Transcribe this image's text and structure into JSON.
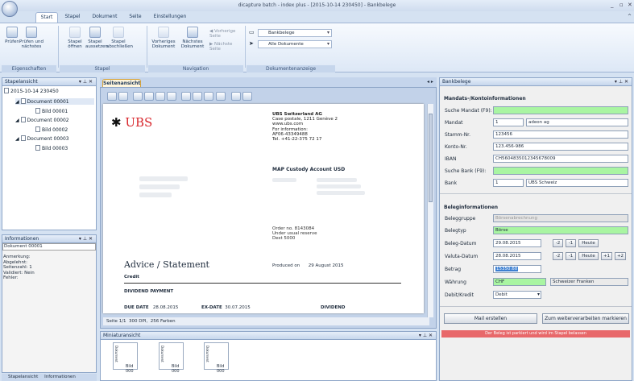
{
  "window": {
    "title": "dicapture batch - index plus - [2015-10-14 230450] - Bankbelege"
  },
  "tabs": [
    "Start",
    "Stapel",
    "Dokument",
    "Seite",
    "Einstellungen"
  ],
  "ribbon": {
    "groups": [
      "Eigenschaften",
      "Stapel",
      "Navigation",
      "Dokumentenanzeige"
    ],
    "buttons": {
      "pruefen": "Prüfen",
      "pruefen_naechstes": "Prüfen und nächstes",
      "stapel_oeffnen": "Stapel öffnen",
      "stapel_aussetzen": "Stapel aussetzen",
      "stapel_abschliessen": "Stapel abschließen",
      "vorheriges_dokument": "Vorheriges Dokument",
      "naechstes_dokument": "Nächstes Dokument",
      "vorherige_seite": "Vorherige Seite",
      "naechste_seite": "Nächste Seite"
    },
    "dropdown1": "Bankbelege",
    "dropdown2": "Alle Dokumente"
  },
  "stapel_panel": {
    "title": "Stapelansicht",
    "root": "2015-10-14 230450",
    "items": [
      "Document 00001",
      "Bild 00001",
      "Document 00002",
      "Bild 00002",
      "Document 00003",
      "Bild 00003"
    ]
  },
  "info_panel": {
    "title": "Informationen",
    "doc": "Dokument 00001",
    "lines": [
      "Anmerkung:",
      "Abgelehnt:",
      "Seitenzahl: 1",
      "Validiert: Nein",
      "Fehler:"
    ]
  },
  "bottom_tabs": [
    "Stapelansicht",
    "Informationen"
  ],
  "viewer": {
    "tab": "Seitenansicht",
    "status": {
      "page": "Seite 1/1",
      "dpi": "300 DPI,",
      "colors": "256 Farben"
    },
    "doc": {
      "bank_name": "UBS",
      "addr": [
        "UBS Switzerland AG",
        "Case postale, 1211 Genève 2",
        "www.ubs.com",
        "",
        "For information:",
        "AF06-43349488",
        "Tel. +41-22-375 72 17"
      ],
      "custody": "MAP Custody Account USD",
      "order": [
        "Order no. 8143084",
        "Under usual reserve",
        "Dest 5000"
      ],
      "heading": "Advice / Statement",
      "produced_label": "Produced on",
      "produced_date": "29 August 2015",
      "credit": "Credit",
      "dividend_payment": "DIVIDEND PAYMENT",
      "due_date_label": "DUE DATE",
      "due_date": "28.08.2015",
      "ex_date_label": "EX-DATE",
      "ex_date": "30.07.2015",
      "dividend": "DIVIDEND"
    }
  },
  "miniatur": {
    "title": "Miniaturansicht",
    "items": [
      "Bild 000",
      "Bild 000",
      "Bild 000"
    ],
    "thumb_tag": "Dokument"
  },
  "right_panel": {
    "title": "Bankbelege",
    "section1": "Mandats-/Kontoinformationen",
    "suche_mandat_label": "Suche Mandat (F9):",
    "mandat_label": "Mandat",
    "mandat_value": "1",
    "mandat_name": "adeon ag",
    "stamm_label": "Stamm-Nr.",
    "stamm_value": "123456",
    "konto_label": "Konto-Nr.",
    "konto_value": "123.456-986",
    "iban_label": "IBAN",
    "iban_value": "CH5604835012345678009",
    "suche_bank_label": "Suche Bank (F9):",
    "bank_label": "Bank",
    "bank_value": "1",
    "bank_name": "UBS Schweiz",
    "section2": "Beleginformationen",
    "beleggruppe_label": "Beleggruppe",
    "beleggruppe_value": "Börsenabrechnung",
    "belegtyp_label": "Belegtyp",
    "belegtyp_value": "Börse",
    "belegdatum_label": "Beleg-Datum",
    "belegdatum_value": "29.08.2015",
    "valuta_label": "Valuta-Datum",
    "valuta_value": "28.08.2015",
    "betrag_label": "Betrag",
    "betrag_value": "15350.60",
    "waehrung_label": "Währung",
    "waehrung_value": "CHF",
    "waehrung_name": "Schweizer Franken",
    "debit_label": "Debit/Kredit",
    "debit_value": "Debit",
    "btn_minus2": "-2",
    "btn_minus1": "-1",
    "btn_heute": "Heute",
    "btn_plus1": "+1",
    "btn_plus2": "+2",
    "mail_btn": "Mail erstellen",
    "weiter_btn": "Zum weiterverarbeiten markieren",
    "status_msg": "Der Beleg ist parkiert und wird im Stapel belassen"
  },
  "colors": {
    "accent": "#3c7fd1",
    "green_field": "#a9f5a2",
    "error_bar": "#e8686a"
  }
}
